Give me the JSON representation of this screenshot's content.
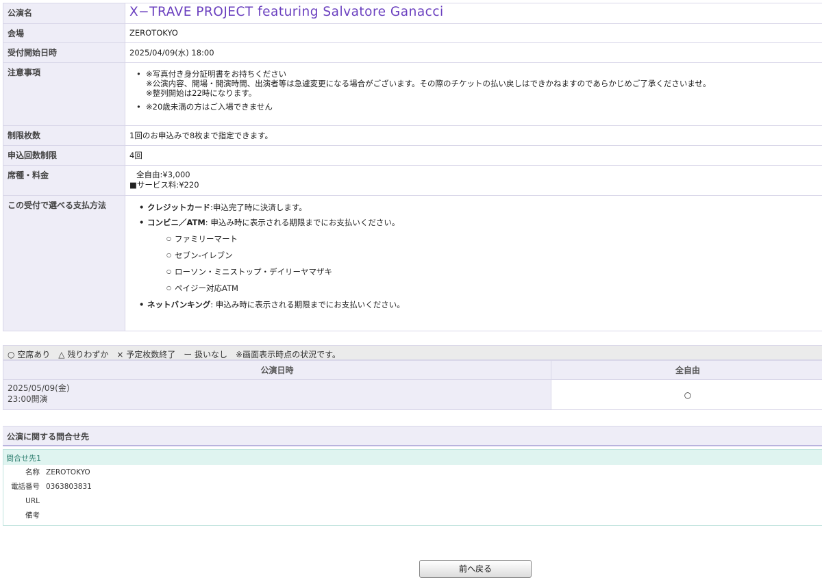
{
  "info": {
    "title_label": "公演名",
    "title_value": "X−TRAVE PROJECT featuring Salvatore Ganacci",
    "venue_label": "会場",
    "venue_value": "ZEROTOKYO",
    "start_label": "受付開始日時",
    "start_value": "2025/04/09(水) 18:00",
    "notes_label": "注意事項",
    "notes": [
      {
        "lines": [
          "※写真付き身分証明書をお持ちください",
          "※公演内容、開場・開演時間、出演者等は急遽変更になる場合がございます。その際のチケットの払い戻しはできかねますのであらかじめご了承くださいませ。",
          "※整列開始は22時になります。"
        ]
      },
      {
        "lines": [
          "※20歳未満の方はご入場できません"
        ]
      }
    ],
    "limit_label": "制限枚数",
    "limit_value": "1回のお申込みで8枚まで指定できます。",
    "count_label": "申込回数制限",
    "count_value": "4回",
    "price_label": "席種・料金",
    "price_line1": "全自由:¥3,000",
    "price_line2": "■サービス料:¥220",
    "payment_label": "この受付で選べる支払方法",
    "payment": {
      "credit_name": "クレジットカード",
      "credit_desc": ":申込完了時に決済します。",
      "conv_name": "コンビニ／ATM",
      "conv_desc": ": 申込み時に表示される期限までにお支払いください。",
      "stores": [
        "ファミリーマート",
        "セブン-イレブン",
        "ローソン・ミニストップ・デイリーヤマザキ",
        "ペイジー対応ATM"
      ],
      "net_name": "ネットバンキング",
      "net_desc": ": 申込み時に表示される期限までにお支払いください。"
    }
  },
  "availability": {
    "legend": "○ 空席あり　△ 残りわずか　× 予定枚数終了　ー 扱いなし　※画面表示時点の状況です。",
    "col_date": "公演日時",
    "col_seat": "全自由",
    "rows": [
      {
        "date": "2025/05/09(金)",
        "time": "23:00開演",
        "status": "○"
      }
    ]
  },
  "contact": {
    "heading": "公演に関する問合せ先",
    "sub_heading": "問合せ先1",
    "name_label": "名称",
    "name_value": "ZEROTOKYO",
    "phone_label": "電話番号",
    "phone_value": "0363803831",
    "url_label": "URL",
    "url_value": "",
    "remark_label": "備考",
    "remark_value": ""
  },
  "back_button_label": "前へ戻る"
}
